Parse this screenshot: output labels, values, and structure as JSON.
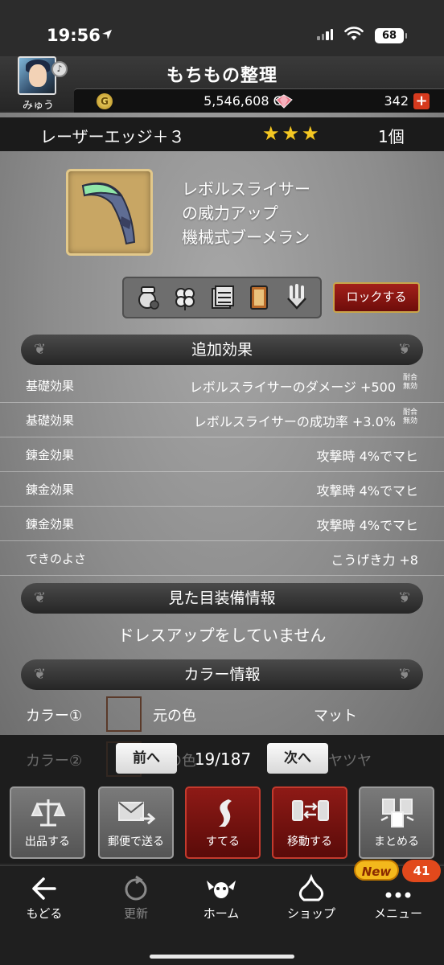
{
  "status_bar": {
    "time": "19:56",
    "battery": "68"
  },
  "header": {
    "title": "もちもの整理",
    "player_name": "みゅう",
    "gold": "5,546,608 G",
    "gems": "342",
    "plus": "+"
  },
  "item": {
    "name": "レーザーエッジ＋３",
    "stars": [
      "★",
      "★",
      "★"
    ],
    "count": "1個",
    "desc_lines": [
      "レボルスライサー",
      "の威力アップ",
      "機械式ブーメラン"
    ],
    "lock_label": "ロックする"
  },
  "sections": {
    "effects_title": "追加効果",
    "appearance_title": "見た目装備情報",
    "dress_status": "ドレスアップをしていません",
    "color_title": "カラー情報"
  },
  "effects": [
    {
      "label": "基礎効果",
      "value": "レボルスライサーのダメージ +500",
      "badge": "耐合無効"
    },
    {
      "label": "基礎効果",
      "value": "レボルスライサーの成功率 +3.0%",
      "badge": "耐合無効"
    },
    {
      "label": "錬金効果",
      "value": "攻撃時 4%でマヒ",
      "badge": ""
    },
    {
      "label": "錬金効果",
      "value": "攻撃時 4%でマヒ",
      "badge": ""
    },
    {
      "label": "錬金効果",
      "value": "攻撃時 4%でマヒ",
      "badge": ""
    },
    {
      "label": "できのよさ",
      "value": "こうげき力 +8",
      "badge": ""
    }
  ],
  "colors": [
    {
      "label": "カラー①",
      "name": "元の色",
      "finish": "マット"
    },
    {
      "label": "カラー②",
      "name": "元の色",
      "finish": "ツヤツヤ"
    }
  ],
  "pager": {
    "prev": "前へ",
    "position": "19/187",
    "next": "次へ"
  },
  "actions": [
    {
      "label": "出品する",
      "icon": "scale-icon"
    },
    {
      "label": "郵便で送る",
      "icon": "mail-icon"
    },
    {
      "label": "すてる",
      "icon": "discard-icon"
    },
    {
      "label": "移動する",
      "icon": "transfer-icon"
    },
    {
      "label": "まとめる",
      "icon": "bundle-icon"
    }
  ],
  "nav": [
    {
      "label": "もどる",
      "icon": "back-arrow-icon"
    },
    {
      "label": "更新",
      "icon": "refresh-icon"
    },
    {
      "label": "ホーム",
      "icon": "home-dracky-icon"
    },
    {
      "label": "ショップ",
      "icon": "slime-shop-icon"
    },
    {
      "label": "メニュー",
      "icon": "menu-dots-icon"
    }
  ],
  "badges": {
    "new": "New",
    "count": "41"
  }
}
